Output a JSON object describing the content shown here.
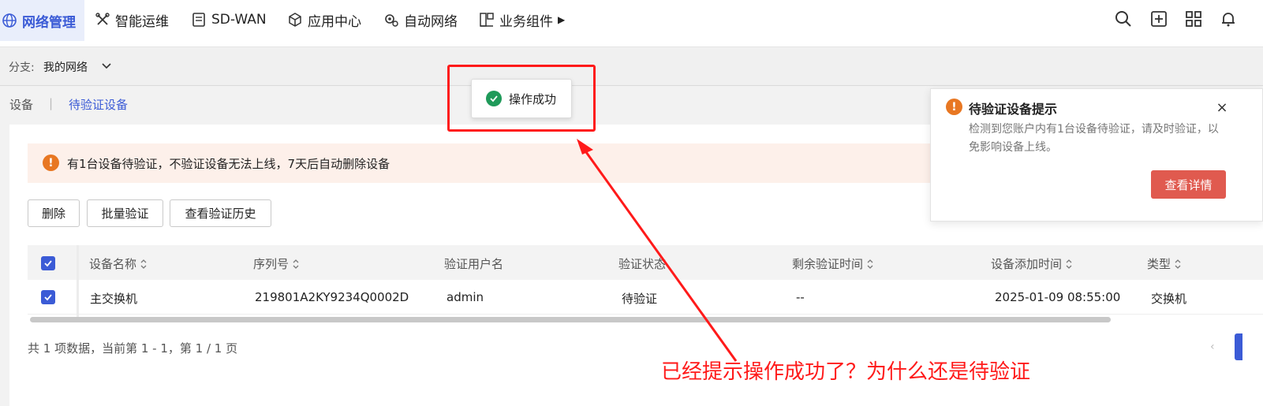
{
  "nav": {
    "items": [
      {
        "label": "网络管理",
        "icon": "globe-icon"
      },
      {
        "label": "智能运维",
        "icon": "tools-icon"
      },
      {
        "label": "SD-WAN",
        "icon": "clipboard-icon"
      },
      {
        "label": "应用中心",
        "icon": "cube-icon"
      },
      {
        "label": "自动网络",
        "icon": "gears-icon"
      },
      {
        "label": "业务组件",
        "icon": "blocks-icon"
      }
    ],
    "tools": [
      "search-icon",
      "add-icon",
      "grid-icon",
      "bell-icon"
    ]
  },
  "branch": {
    "label": "分支:",
    "value": "我的网络"
  },
  "breadcrumb": {
    "tab1": "设备",
    "sep": "|",
    "tab2": "待验证设备"
  },
  "alert": {
    "text": "有1台设备待验证，不验证设备无法上线，7天后自动删除设备",
    "icon": "!"
  },
  "buttons": {
    "delete": "删除",
    "batch_verify": "批量验证",
    "history": "查看验证历史"
  },
  "table": {
    "columns": [
      "设备名称",
      "序列号",
      "验证用户名",
      "验证状态",
      "剩余验证时间",
      "设备添加时间",
      "类型"
    ],
    "rows": [
      {
        "name": "主交换机",
        "serial": "219801A2KY9234Q0002D",
        "user": "admin",
        "status": "待验证",
        "remaining": "--",
        "added": "2025-01-09 08:55:00",
        "type": "交换机"
      }
    ]
  },
  "pager": {
    "text": "共 1 项数据，当前第 1 - 1，第 1 / 1 页",
    "prev": "‹"
  },
  "toast": {
    "text": "操作成功"
  },
  "notice": {
    "title": "待验证设备提示",
    "body": "检测到您账户内有1台设备待验证，请及时验证，以免影响设备上线。",
    "button": "查看详情",
    "close": "×",
    "icon": "!"
  },
  "annotation": {
    "text": "已经提示操作成功了？为什么还是待验证",
    "color": "#ff1a1a"
  },
  "colors": {
    "accent": "#3b5bd6",
    "warning": "#e87722",
    "success": "#1f9a5a",
    "danger": "#e05a4f"
  }
}
